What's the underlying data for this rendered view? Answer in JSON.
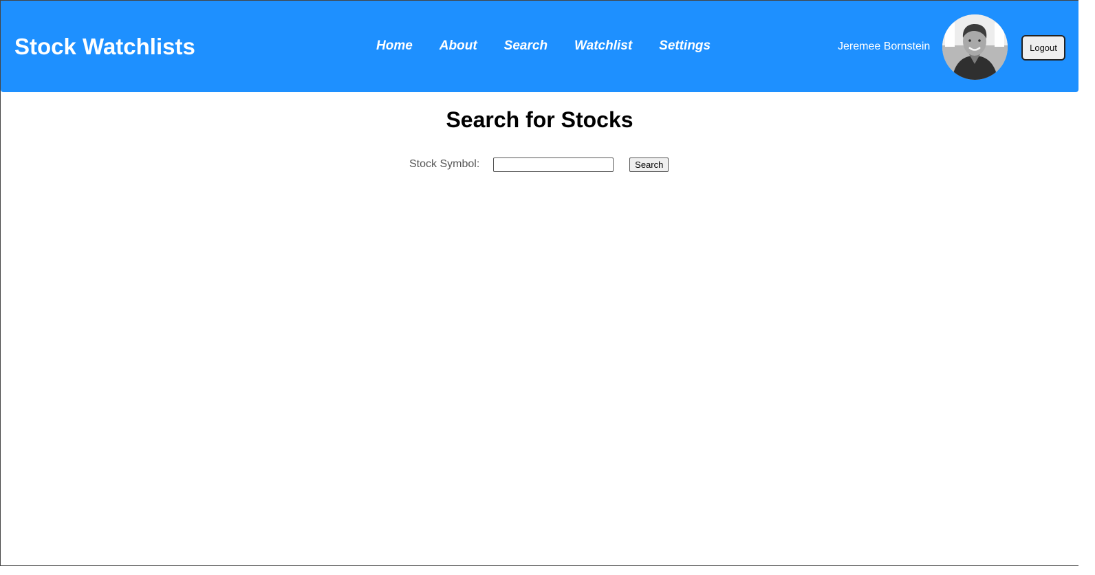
{
  "header": {
    "brand": "Stock Watchlists",
    "nav": [
      "Home",
      "About",
      "Search",
      "Watchlist",
      "Settings"
    ],
    "user_name": "Jeremee Bornstein",
    "logout_label": "Logout",
    "accent_color": "#1e90ff"
  },
  "main": {
    "title": "Search for Stocks",
    "search": {
      "label": "Stock Symbol:",
      "value": "",
      "placeholder": "",
      "button_label": "Search"
    }
  }
}
